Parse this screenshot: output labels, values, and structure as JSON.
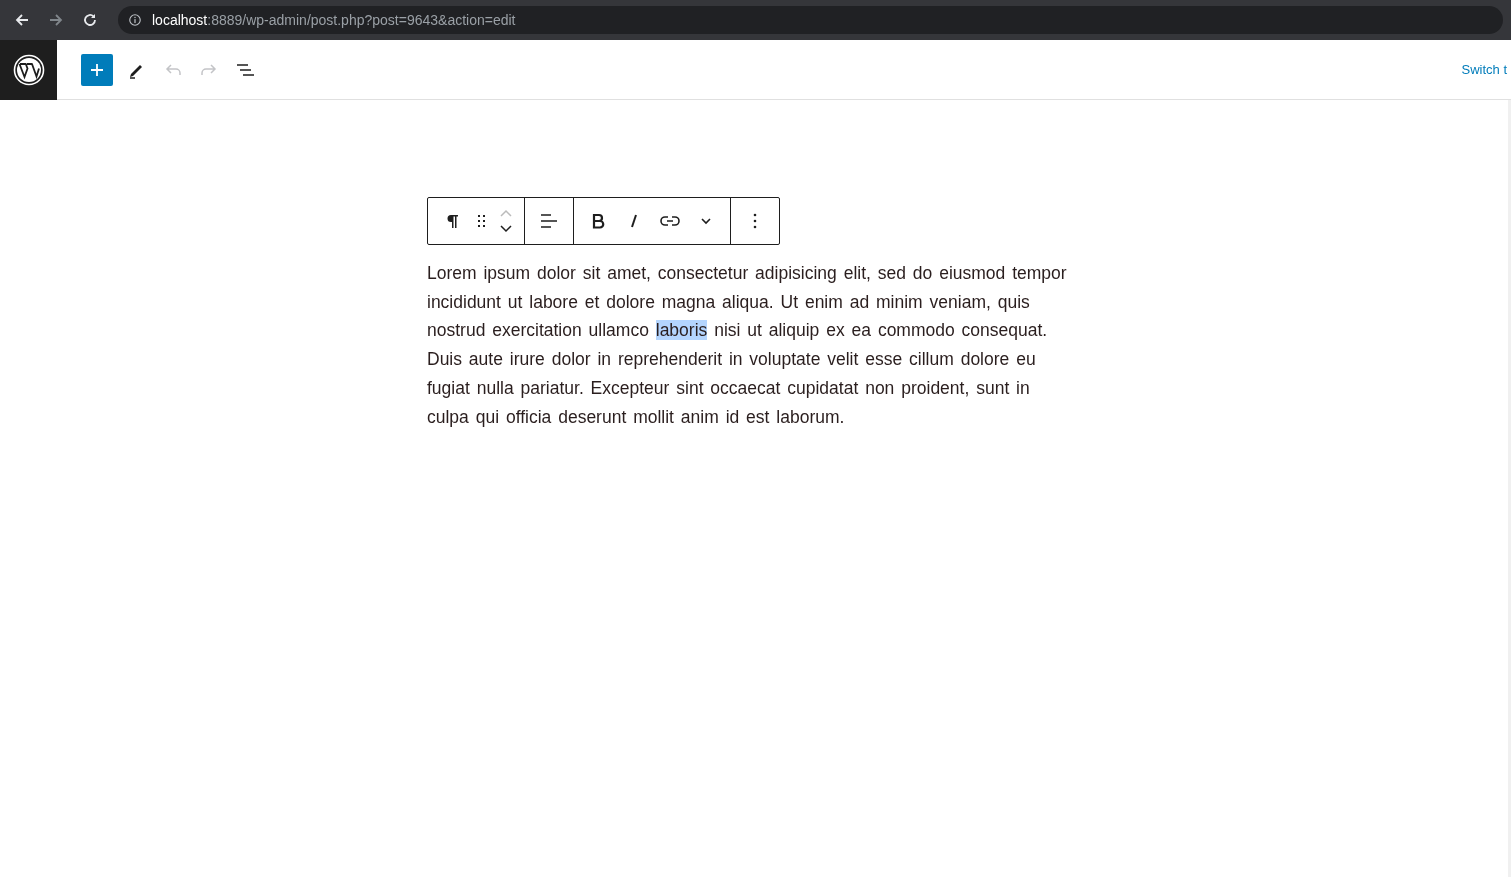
{
  "browser": {
    "url_host": "localhost",
    "url_rest": ":8889/wp-admin/post.php?post=9643&action=edit",
    "forward_disabled": true
  },
  "header": {
    "undo_disabled": true,
    "redo_disabled": true,
    "switch_link": "Switch t"
  },
  "post": {
    "paragraph": {
      "before": "Lorem ipsum dolor sit amet, consectetur adipisicing elit, sed do eiusmod tempor incididunt ut labore et dolore magna aliqua. Ut enim ad minim veniam, quis nostrud exercitation ullamco ",
      "selected": "laboris",
      "after": " nisi ut aliquip ex ea commodo consequat. Duis aute irure dolor in reprehenderit in voluptate velit esse cillum dolore eu fugiat nulla pariatur. Excepteur sint occaecat cupidatat non proident, sunt in culpa qui officia deserunt mollit anim id est laborum."
    }
  },
  "block_toolbar": {
    "move_up_disabled": true,
    "move_down_disabled": false
  }
}
